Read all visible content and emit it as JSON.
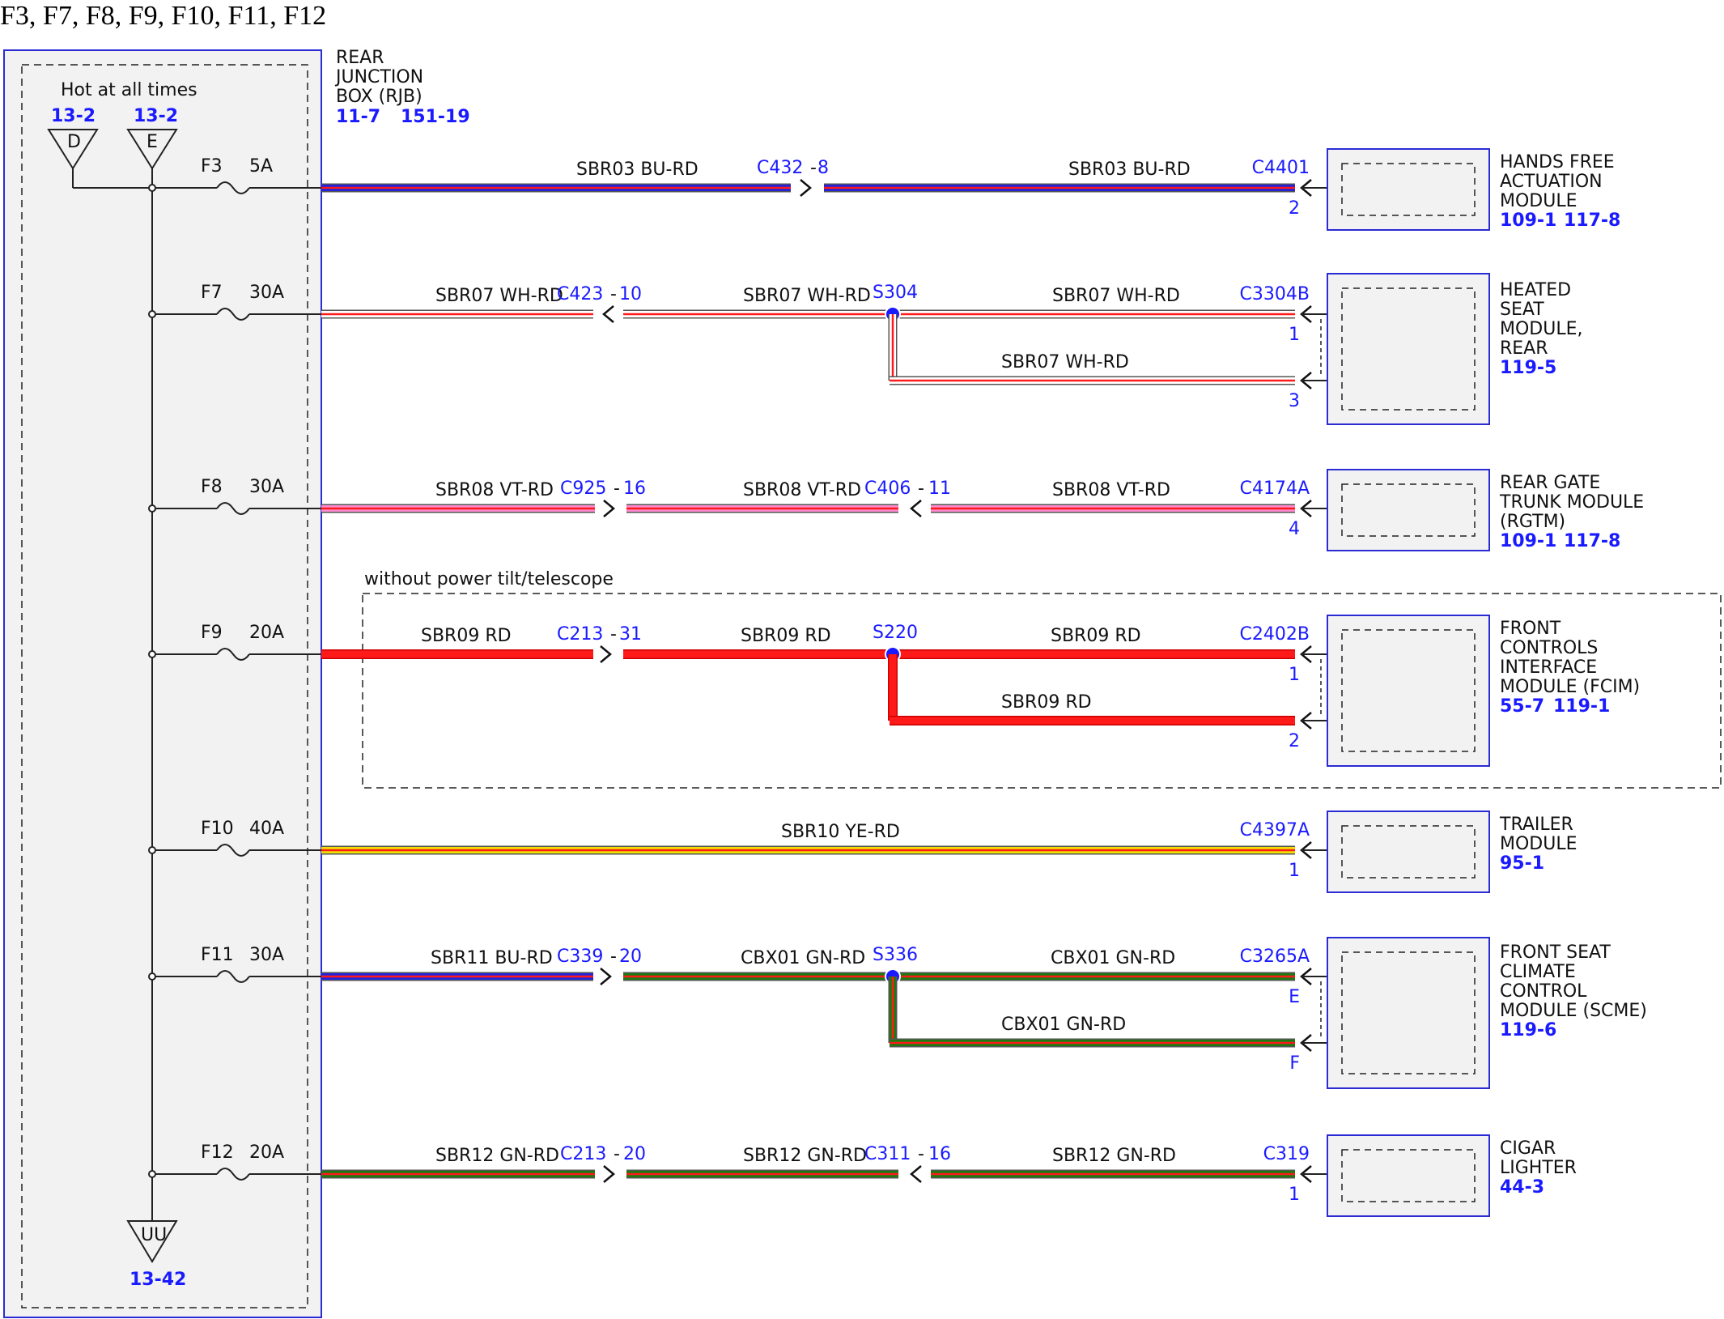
{
  "title": "F3, F7, F8, F9, F10, F11, F12",
  "rjb": {
    "name_lines": [
      "REAR",
      "JUNCTION",
      "BOX (RJB)"
    ],
    "refs": [
      "11-7",
      "151-19"
    ],
    "hot_label": "Hot at all times",
    "sources": [
      {
        "ref": "13-2",
        "letter": "D"
      },
      {
        "ref": "13-2",
        "letter": "E"
      }
    ],
    "ground": {
      "letter": "UU",
      "ref": "13-42"
    }
  },
  "optional_group": {
    "label": "without power tilt/telescope"
  },
  "circuits": [
    {
      "fuse": "F3",
      "rating": "5A",
      "segments": [
        {
          "wire": "SBR03  BU-RD",
          "color": "blue-red"
        },
        {
          "connector": "C432",
          "pin": "8"
        },
        {
          "wire": "SBR03  BU-RD",
          "color": "blue-red"
        }
      ],
      "end_connector": "C4401",
      "end_pins": [
        "2"
      ],
      "module": {
        "lines": [
          "HANDS FREE",
          "ACTUATION",
          "MODULE"
        ],
        "refs": [
          "109-1",
          "117-8"
        ]
      }
    },
    {
      "fuse": "F7",
      "rating": "30A",
      "segments": [
        {
          "wire": "SBR07  WH-RD",
          "color": "white-red"
        },
        {
          "connector": "C423",
          "pin": "10"
        },
        {
          "wire": "SBR07  WH-RD",
          "color": "white-red"
        },
        {
          "splice": "S304"
        },
        {
          "wire": "SBR07  WH-RD",
          "color": "white-red"
        }
      ],
      "branch_wire": "SBR07  WH-RD",
      "end_connector": "C3304B",
      "end_pins": [
        "1",
        "3"
      ],
      "module": {
        "lines": [
          "HEATED",
          "SEAT",
          "MODULE,",
          "REAR"
        ],
        "refs": [
          "119-5"
        ]
      }
    },
    {
      "fuse": "F8",
      "rating": "30A",
      "segments": [
        {
          "wire": "SBR08  VT-RD",
          "color": "violet-red"
        },
        {
          "connector": "C925",
          "pin": "16"
        },
        {
          "wire": "SBR08  VT-RD",
          "color": "violet-red"
        },
        {
          "connector": "C406",
          "pin": "11"
        },
        {
          "wire": "SBR08  VT-RD",
          "color": "violet-red"
        }
      ],
      "end_connector": "C4174A",
      "end_pins": [
        "4"
      ],
      "module": {
        "lines": [
          "REAR GATE",
          "TRUNK MODULE",
          "(RGTM)"
        ],
        "refs": [
          "109-1",
          "117-8"
        ]
      }
    },
    {
      "fuse": "F9",
      "rating": "20A",
      "segments": [
        {
          "wire": "SBR09  RD",
          "color": "red"
        },
        {
          "connector": "C213",
          "pin": "31"
        },
        {
          "wire": "SBR09  RD",
          "color": "red"
        },
        {
          "splice": "S220"
        },
        {
          "wire": "SBR09  RD",
          "color": "red"
        }
      ],
      "branch_wire": "SBR09  RD",
      "end_connector": "C2402B",
      "end_pins": [
        "1",
        "2"
      ],
      "module": {
        "lines": [
          "FRONT",
          "CONTROLS",
          "INTERFACE",
          "MODULE (FCIM)"
        ],
        "refs": [
          "55-7",
          "119-1"
        ]
      }
    },
    {
      "fuse": "F10",
      "rating": "40A",
      "segments": [
        {
          "wire": "SBR10  YE-RD",
          "color": "yellow-red"
        }
      ],
      "end_connector": "C4397A",
      "end_pins": [
        "1"
      ],
      "module": {
        "lines": [
          "TRAILER",
          "MODULE"
        ],
        "refs": [
          "95-1"
        ]
      }
    },
    {
      "fuse": "F11",
      "rating": "30A",
      "segments": [
        {
          "wire": "SBR11  BU-RD",
          "color": "blue-red"
        },
        {
          "connector": "C339",
          "pin": "20"
        },
        {
          "wire": "CBX01  GN-RD",
          "color": "green-red"
        },
        {
          "splice": "S336"
        },
        {
          "wire": "CBX01  GN-RD",
          "color": "green-red"
        }
      ],
      "branch_wire": "CBX01  GN-RD",
      "end_connector": "C3265A",
      "end_pins": [
        "E",
        "F"
      ],
      "module": {
        "lines": [
          "FRONT SEAT",
          "CLIMATE",
          "CONTROL",
          "MODULE (SCME)"
        ],
        "refs": [
          "119-6"
        ]
      }
    },
    {
      "fuse": "F12",
      "rating": "20A",
      "segments": [
        {
          "wire": "SBR12  GN-RD",
          "color": "green-red"
        },
        {
          "connector": "C213",
          "pin": "20"
        },
        {
          "wire": "SBR12  GN-RD",
          "color": "green-red"
        },
        {
          "connector": "C311",
          "pin": "16"
        },
        {
          "wire": "SBR12  GN-RD",
          "color": "green-red"
        }
      ],
      "end_connector": "C319",
      "end_pins": [
        "1"
      ],
      "module": {
        "lines": [
          "CIGAR",
          "LIGHTER"
        ],
        "refs": [
          "44-3"
        ]
      }
    }
  ],
  "colors": {
    "label_blue": "#1a1aff",
    "box_border": "#2b2bd6",
    "box_fill": "#f2f2f2",
    "blue": "#2222dd",
    "red": "#ff1a1a",
    "white": "#ffffff",
    "violet": "#ff8ad0",
    "yellow": "#f0e000",
    "green": "#1e7a10",
    "splice": "#1a1aff"
  }
}
